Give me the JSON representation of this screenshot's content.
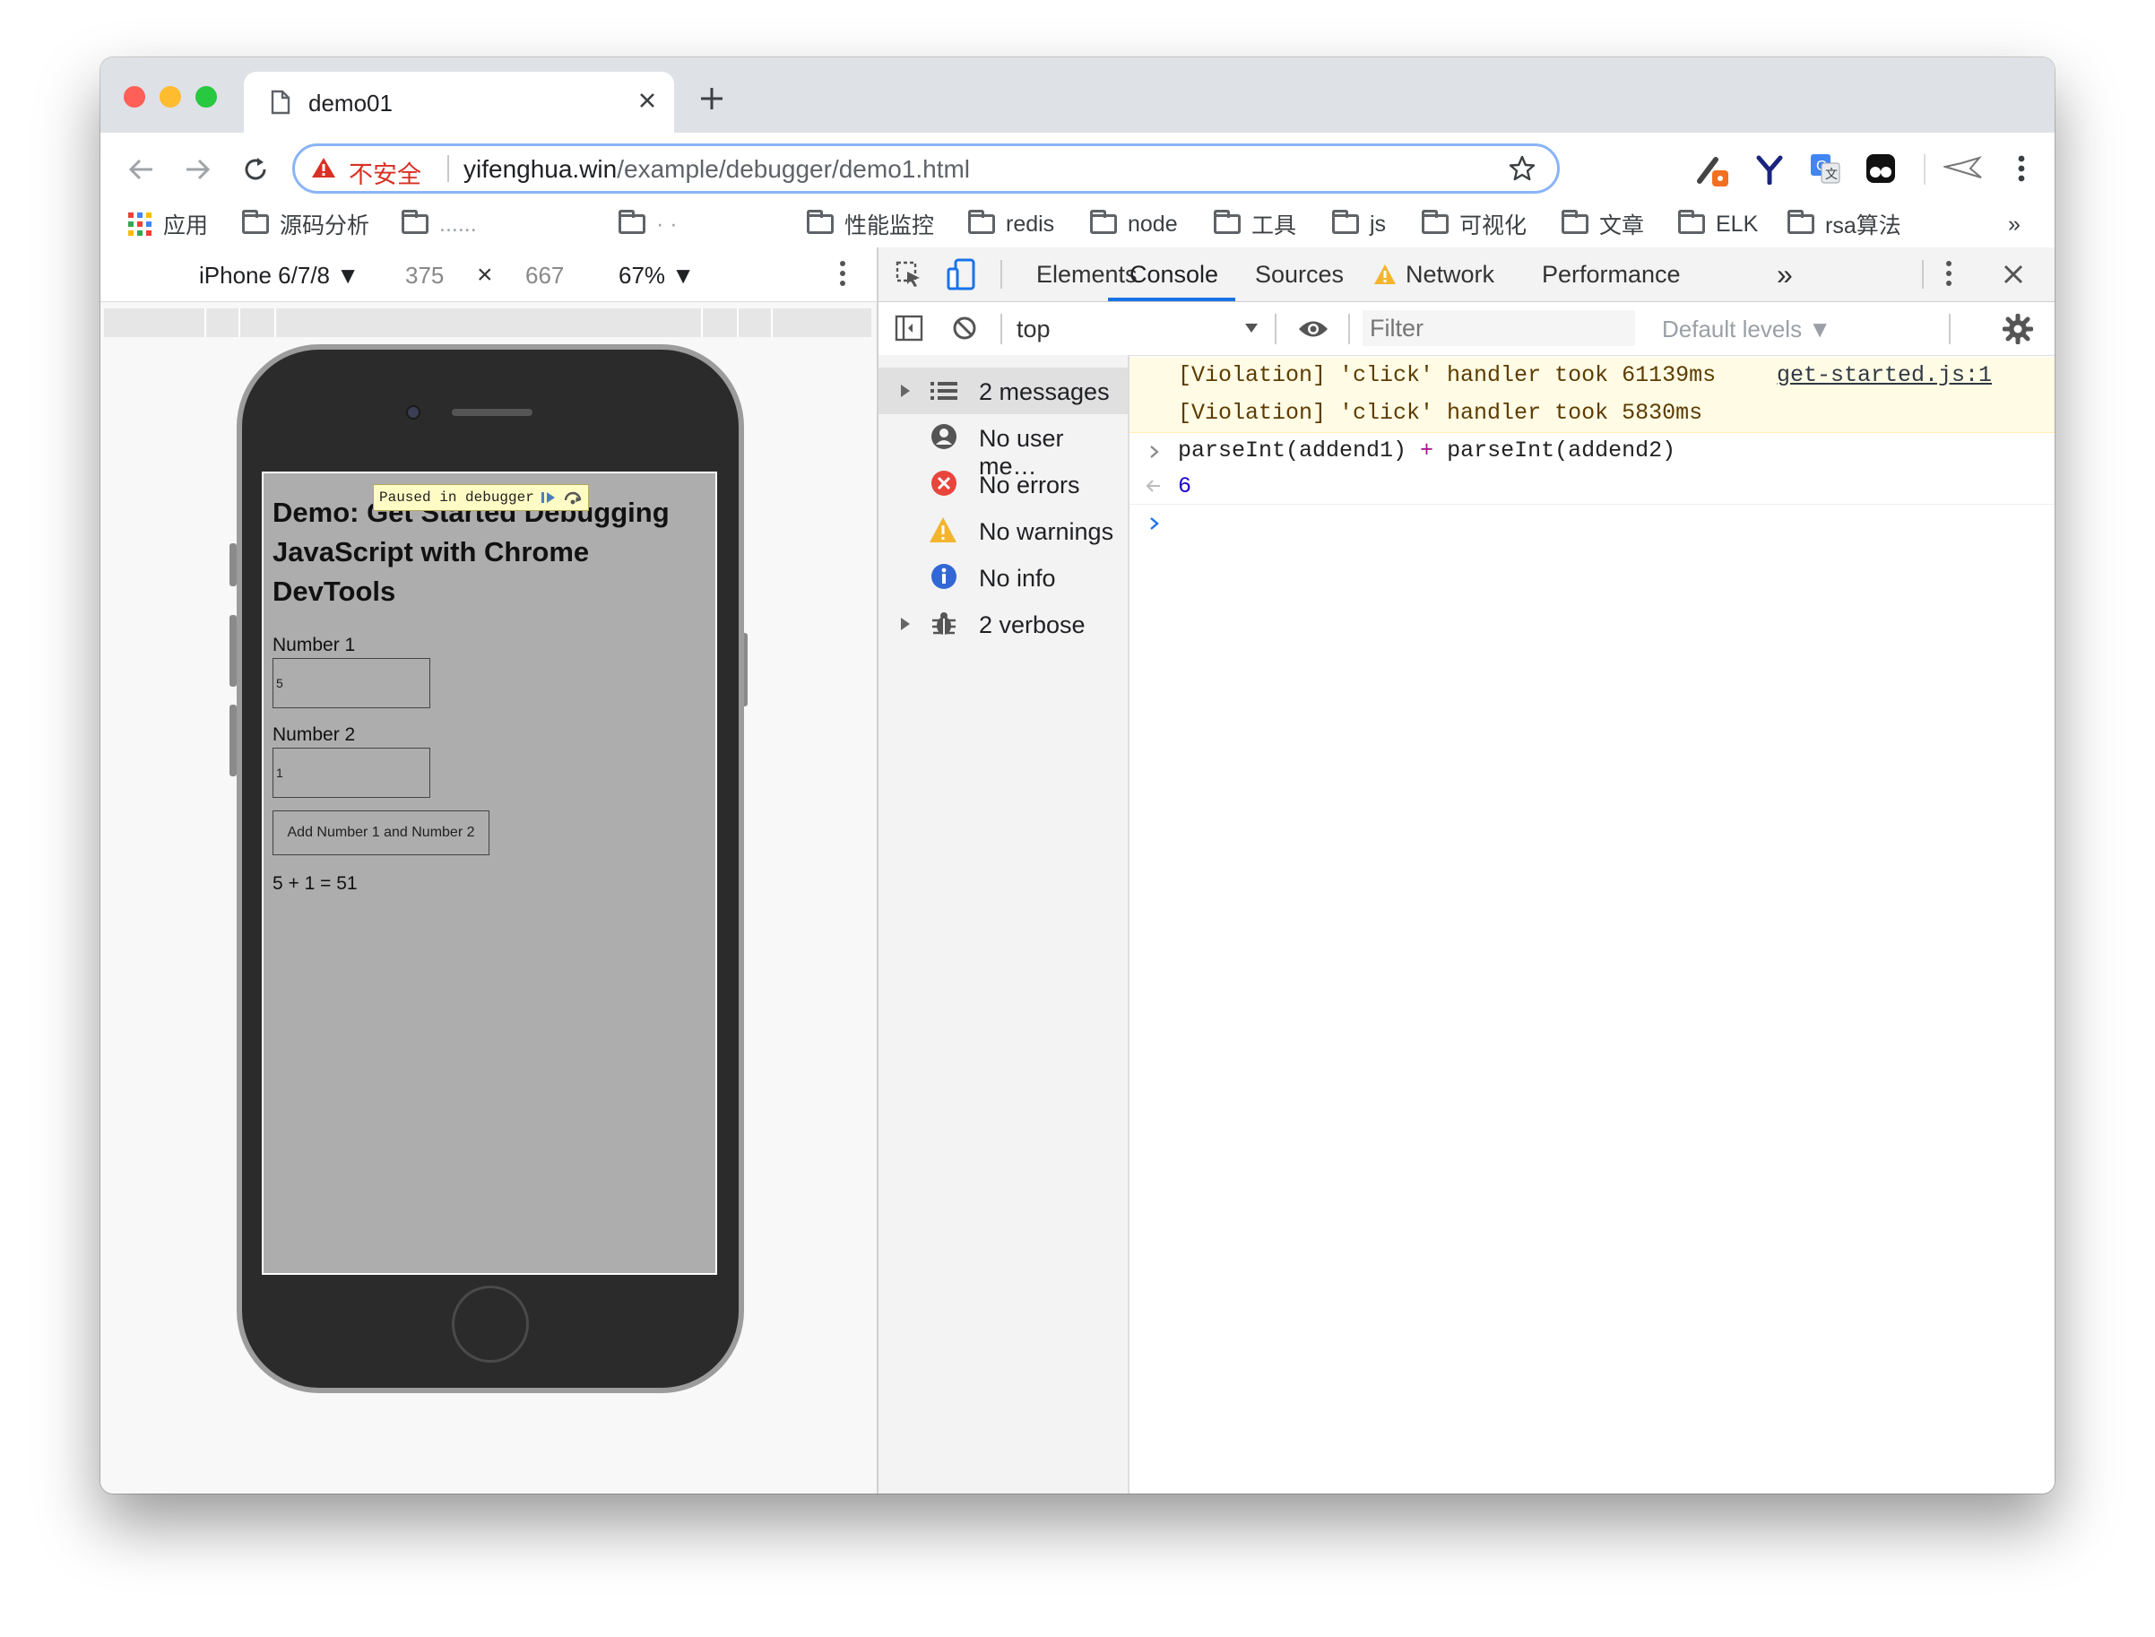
{
  "browser": {
    "tab_title": "demo01",
    "url_security": "不安全",
    "url_host": "yifenghua.win",
    "url_path": "/example/debugger/demo1.html",
    "bookmarks": [
      {
        "label": "应用"
      },
      {
        "label": "源码分析"
      },
      {
        "label": "......"
      },
      {
        "label": "· ·"
      },
      {
        "label": "性能监控"
      },
      {
        "label": "redis"
      },
      {
        "label": "node"
      },
      {
        "label": "工具"
      },
      {
        "label": "js"
      },
      {
        "label": "可视化"
      },
      {
        "label": "文章"
      },
      {
        "label": "ELK"
      },
      {
        "label": "rsa算法"
      }
    ],
    "more_bookmarks": "»"
  },
  "device_toolbar": {
    "device": "iPhone 6/7/8 ▼",
    "width": "375",
    "times": "×",
    "height": "667",
    "zoom": "67% ▼"
  },
  "page": {
    "paused_label": "Paused in debugger",
    "heading": "Demo: Get Started Debugging JavaScript with Chrome DevTools",
    "number1_label": "Number 1",
    "number1_value": "5",
    "number2_label": "Number 2",
    "number2_value": "1",
    "button_label": "Add Number 1 and Number 2",
    "result": "5 + 1 = 51"
  },
  "devtools": {
    "tabs": {
      "elements": "Elements",
      "console": "Console",
      "sources": "Sources",
      "network": "Network",
      "performance": "Performance",
      "more": "»"
    },
    "context": "top",
    "filter_placeholder": "Filter",
    "levels": "Default levels ▼",
    "sidebar": {
      "messages": "2 messages",
      "user": "No user me…",
      "errors": "No errors",
      "warnings": "No warnings",
      "info": "No info",
      "verbose": "2 verbose"
    },
    "console": {
      "violation1": "[Violation] 'click' handler took 61139ms",
      "violation1_source": "get-started.js:1",
      "violation2": "[Violation] 'click' handler took 5830ms",
      "input_a": "parseInt(addend1)",
      "input_op": " + ",
      "input_b": "parseInt(addend2)",
      "result": "6"
    }
  },
  "colors": {
    "accent": "#1a73e8",
    "warning_bg": "#fffbe5",
    "insecure": "#d93025",
    "phone_screen": "#adadad"
  }
}
